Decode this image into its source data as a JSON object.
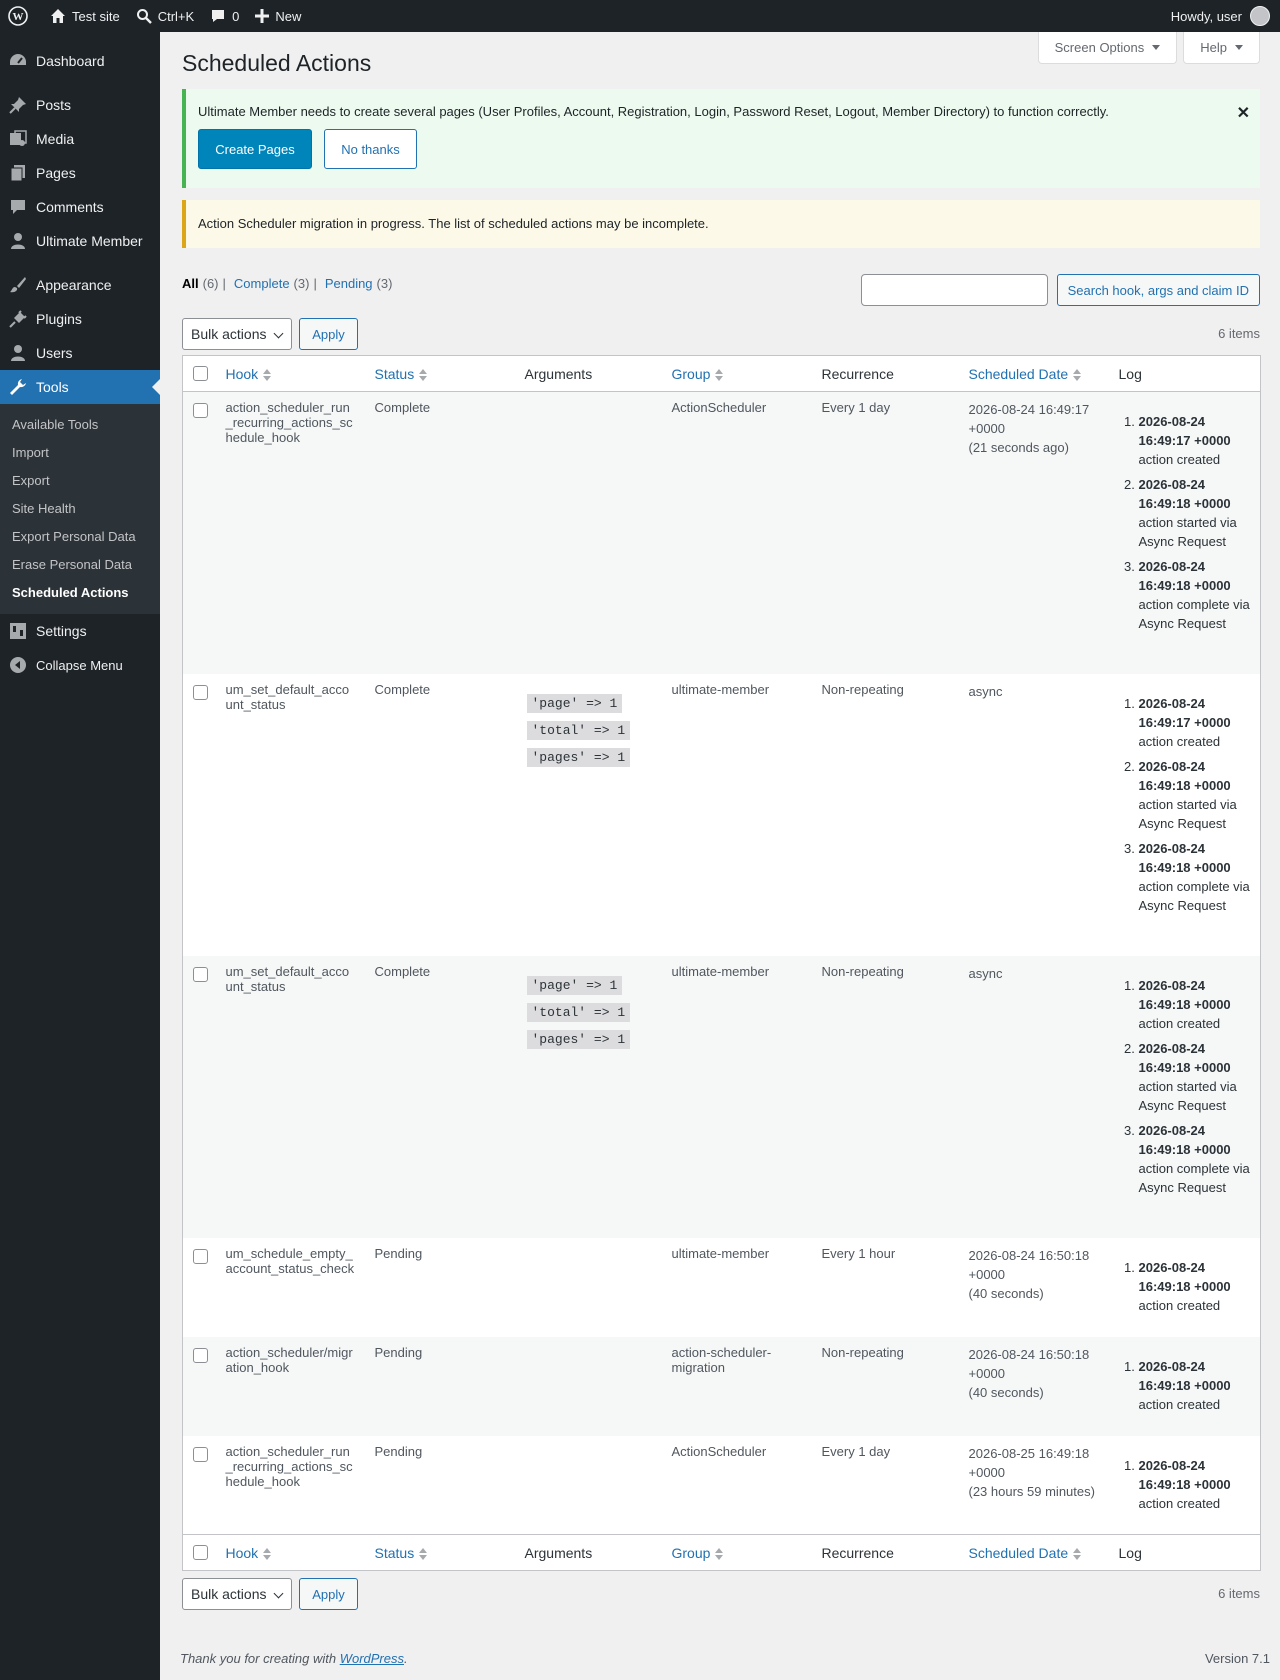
{
  "adminbar": {
    "site_name": "Test site",
    "search_shortcut": "Ctrl+K",
    "comments_count": "0",
    "new_label": "New",
    "howdy": "Howdy, user"
  },
  "sidebar": {
    "items": [
      {
        "label": "Dashboard",
        "icon": "dashboard-icon"
      },
      {
        "label": "Posts",
        "icon": "pin-icon"
      },
      {
        "label": "Media",
        "icon": "media-icon"
      },
      {
        "label": "Pages",
        "icon": "pages-icon"
      },
      {
        "label": "Comments",
        "icon": "comment-icon"
      },
      {
        "label": "Ultimate Member",
        "icon": "user-icon"
      },
      {
        "label": "Appearance",
        "icon": "brush-icon"
      },
      {
        "label": "Plugins",
        "icon": "plug-icon"
      },
      {
        "label": "Users",
        "icon": "users-icon"
      },
      {
        "label": "Tools",
        "icon": "wrench-icon"
      },
      {
        "label": "Settings",
        "icon": "settings-icon"
      },
      {
        "label": "Collapse Menu",
        "icon": "collapse-icon"
      }
    ],
    "tools_submenu": [
      "Available Tools",
      "Import",
      "Export",
      "Site Health",
      "Export Personal Data",
      "Erase Personal Data",
      "Scheduled Actions"
    ]
  },
  "header": {
    "title": "Scheduled Actions",
    "screen_options": "Screen Options",
    "help": "Help"
  },
  "notices": {
    "um_message": "Ultimate Member needs to create several pages (User Profiles, Account, Registration, Login, Password Reset, Logout, Member Directory) to function correctly.",
    "create_pages": "Create Pages",
    "no_thanks": "No thanks",
    "migration": "Action Scheduler migration in progress. The list of scheduled actions may be incomplete."
  },
  "filters": {
    "all": "All",
    "all_count": "(6)",
    "complete": "Complete",
    "complete_count": "(3)",
    "pending": "Pending",
    "pending_count": "(3)",
    "sep": "|"
  },
  "search": {
    "button": "Search hook, args and claim ID",
    "value": ""
  },
  "tablenav": {
    "bulk": "Bulk actions",
    "apply": "Apply",
    "count": "6 items"
  },
  "columns": {
    "hook": "Hook",
    "status": "Status",
    "arguments": "Arguments",
    "group": "Group",
    "recurrence": "Recurrence",
    "scheduled": "Scheduled Date",
    "log": "Log"
  },
  "rows": [
    {
      "hook": "action_scheduler_run_recurring_actions_schedule_hook",
      "status": "Complete",
      "args": [],
      "group": "ActionScheduler",
      "recurrence": "Every 1 day",
      "date": [
        "2026-08-24 16:49:17",
        "+0000",
        "(21 seconds ago)"
      ],
      "log": [
        {
          "ts": "2026-08-24 16:49:17 +0000",
          "msg": "action created"
        },
        {
          "ts": "2026-08-24 16:49:18 +0000",
          "msg": "action started via Async Request"
        },
        {
          "ts": "2026-08-24 16:49:18 +0000",
          "msg": "action complete via Async Request"
        }
      ]
    },
    {
      "hook": "um_set_default_account_status",
      "status": "Complete",
      "args": [
        "'page' => 1",
        "'total' => 1",
        "'pages' => 1"
      ],
      "group": "ultimate-member",
      "recurrence": "Non-repeating",
      "date": [
        "async"
      ],
      "log": [
        {
          "ts": "2026-08-24 16:49:17 +0000",
          "msg": "action created"
        },
        {
          "ts": "2026-08-24 16:49:18 +0000",
          "msg": "action started via Async Request"
        },
        {
          "ts": "2026-08-24 16:49:18 +0000",
          "msg": "action complete via Async Request"
        }
      ]
    },
    {
      "hook": "um_set_default_account_status",
      "status": "Complete",
      "args": [
        "'page' => 1",
        "'total' => 1",
        "'pages' => 1"
      ],
      "group": "ultimate-member",
      "recurrence": "Non-repeating",
      "date": [
        "async"
      ],
      "log": [
        {
          "ts": "2026-08-24 16:49:18 +0000",
          "msg": "action created"
        },
        {
          "ts": "2026-08-24 16:49:18 +0000",
          "msg": "action started via Async Request"
        },
        {
          "ts": "2026-08-24 16:49:18 +0000",
          "msg": "action complete via Async Request"
        }
      ]
    },
    {
      "hook": "um_schedule_empty_account_status_check",
      "status": "Pending",
      "args": [],
      "group": "ultimate-member",
      "recurrence": "Every 1 hour",
      "date": [
        "2026-08-24 16:50:18",
        "+0000",
        "(40 seconds)"
      ],
      "log": [
        {
          "ts": "2026-08-24 16:49:18 +0000",
          "msg": "action created"
        }
      ]
    },
    {
      "hook": "action_scheduler/migration_hook",
      "status": "Pending",
      "args": [],
      "group": "action-scheduler-migration",
      "recurrence": "Non-repeating",
      "date": [
        "2026-08-24 16:50:18",
        "+0000",
        "(40 seconds)"
      ],
      "log": [
        {
          "ts": "2026-08-24 16:49:18 +0000",
          "msg": "action created"
        }
      ]
    },
    {
      "hook": "action_scheduler_run_recurring_actions_schedule_hook",
      "status": "Pending",
      "args": [],
      "group": "ActionScheduler",
      "recurrence": "Every 1 day",
      "date": [
        "2026-08-25 16:49:18",
        "+0000",
        "(23 hours 59 minutes)"
      ],
      "log": [
        {
          "ts": "2026-08-24 16:49:18 +0000",
          "msg": "action created"
        }
      ]
    }
  ],
  "footer": {
    "thanks": "Thank you for creating with ",
    "wp_link": "WordPress",
    "period": ".",
    "version": "Version 7.1"
  }
}
